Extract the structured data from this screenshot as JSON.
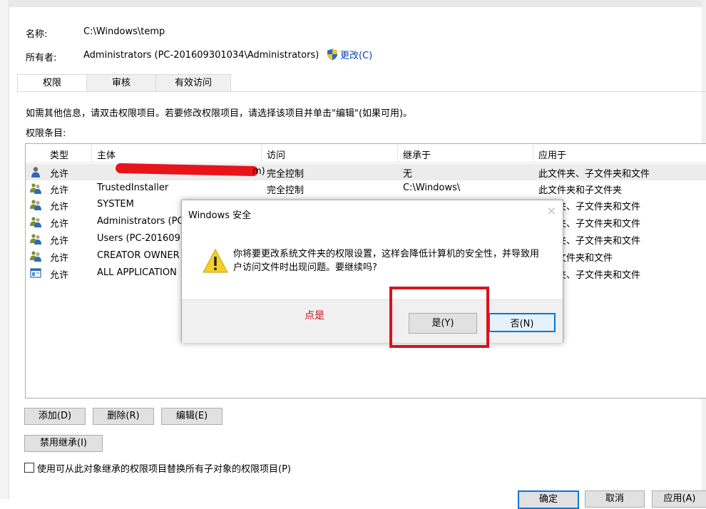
{
  "header": {
    "name_label": "名称:",
    "name_value": "C:\\Windows\\temp",
    "owner_label": "所有者:",
    "owner_value": "Administrators (PC-201609301034\\Administrators)",
    "change_link": "更改(C)"
  },
  "tabs": [
    {
      "label": "权限",
      "active": true
    },
    {
      "label": "审核",
      "active": false
    },
    {
      "label": "有效访问",
      "active": false
    }
  ],
  "info_text": "如需其他信息，请双击权限项目。若要修改权限项目，请选择该项目并单击\"编辑\"(如果可用)。",
  "entries_label": "权限条目:",
  "table": {
    "columns": [
      "类型",
      "主体",
      "访问",
      "继承于",
      "应用于"
    ],
    "rows": [
      {
        "icon": "user-icon",
        "type": "允许",
        "principal": "m)",
        "access": "完全控制",
        "inherited": "无",
        "applies": "此文件夹、子文件夹和文件",
        "selected": true,
        "redacted": true
      },
      {
        "icon": "group-icon",
        "type": "允许",
        "principal": "TrustedInstaller",
        "access": "完全控制",
        "inherited": "C:\\Windows\\",
        "applies": "此文件夹和子文件夹"
      },
      {
        "icon": "group-icon",
        "type": "允许",
        "principal": "SYSTEM",
        "access": "",
        "inherited": "",
        "applies": "夹、子文件夹和文件"
      },
      {
        "icon": "group-icon",
        "type": "允许",
        "principal": "Administrators (PC",
        "access": "",
        "inherited": "",
        "applies": "夹、子文件夹和文件"
      },
      {
        "icon": "group-icon",
        "type": "允许",
        "principal": "Users (PC-201609",
        "access": "",
        "inherited": "",
        "applies": "夹、子文件夹和文件"
      },
      {
        "icon": "group-icon",
        "type": "允许",
        "principal": "CREATOR OWNER",
        "access": "",
        "inherited": "",
        "applies": "文件夹和文件"
      },
      {
        "icon": "app-package-icon",
        "type": "允许",
        "principal": "ALL APPLICATION",
        "access": "",
        "inherited": "",
        "applies": "夹、子文件夹和文件"
      }
    ]
  },
  "buttons": {
    "add": "添加(D)",
    "remove": "删除(R)",
    "edit": "编辑(E)",
    "disable_inheritance": "禁用继承(I)"
  },
  "checkbox": {
    "label": "使用可从此对象继承的权限项目替换所有子对象的权限项目(P)",
    "checked": false
  },
  "bottom_buttons": {
    "ok": "确定",
    "cancel": "取消",
    "apply": "应用(A)"
  },
  "dialog": {
    "title": "Windows 安全",
    "close": "×",
    "message": "你将要更改系统文件夹的权限设置，这样会降低计算机的安全性，并导致用户访问文件时出现问题。要继续吗?",
    "annotation": "点是",
    "yes": "是(Y)",
    "no": "否(N)"
  },
  "colors": {
    "annotation_red": "#d8131b",
    "focus_blue": "#0078d7",
    "link_blue": "#0645ad"
  }
}
